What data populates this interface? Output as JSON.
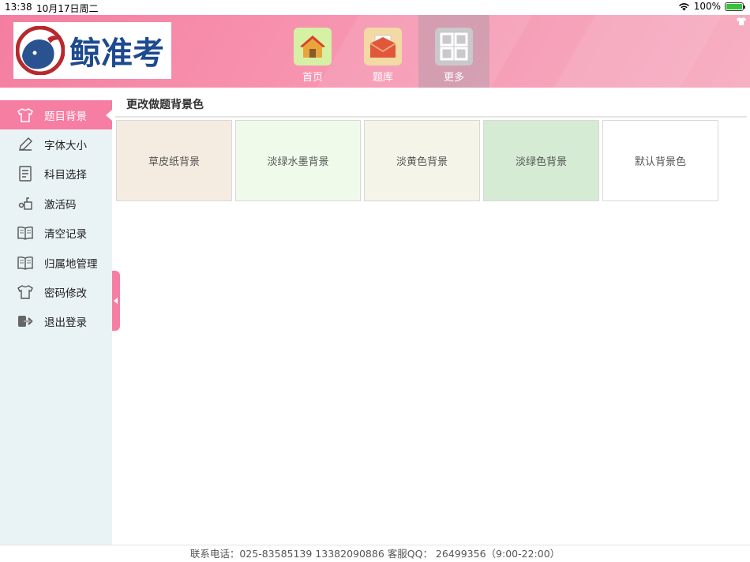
{
  "status_bar": {
    "time": "13:38",
    "date": "10月17日周二",
    "battery": "100%"
  },
  "header": {
    "logo_text": "鲸准考",
    "nav": [
      {
        "label": "首页",
        "icon": "house-icon"
      },
      {
        "label": "题库",
        "icon": "envelope-icon"
      },
      {
        "label": "更多",
        "icon": "grid-icon"
      }
    ]
  },
  "sidebar": {
    "items": [
      {
        "label": "题目背景",
        "icon": "shirt-icon",
        "active": true
      },
      {
        "label": "字体大小",
        "icon": "pencil-icon"
      },
      {
        "label": "科目选择",
        "icon": "document-icon"
      },
      {
        "label": "激活码",
        "icon": "key-icon"
      },
      {
        "label": "清空记录",
        "icon": "book-icon"
      },
      {
        "label": "归属地管理",
        "icon": "book-icon"
      },
      {
        "label": "密码修改",
        "icon": "shirt-outline-icon"
      },
      {
        "label": "退出登录",
        "icon": "logout-icon"
      }
    ]
  },
  "main": {
    "title": "更改做题背景色",
    "options": [
      {
        "label": "草皮纸背景",
        "color": "#f5ece1"
      },
      {
        "label": "淡绿水墨背景",
        "color": "#effaeb"
      },
      {
        "label": "淡黄色背景",
        "color": "#f4f5e8"
      },
      {
        "label": "淡绿色背景",
        "color": "#d5ebd3"
      },
      {
        "label": "默认背景色",
        "color": "#ffffff"
      }
    ]
  },
  "footer": {
    "text": "联系电话：025-83585139  13382090886  客服QQ：  26499356（9:00-22:00）"
  },
  "colors": {
    "accent": "#f57ea2",
    "sidebar_bg": "#e9f3f5"
  }
}
